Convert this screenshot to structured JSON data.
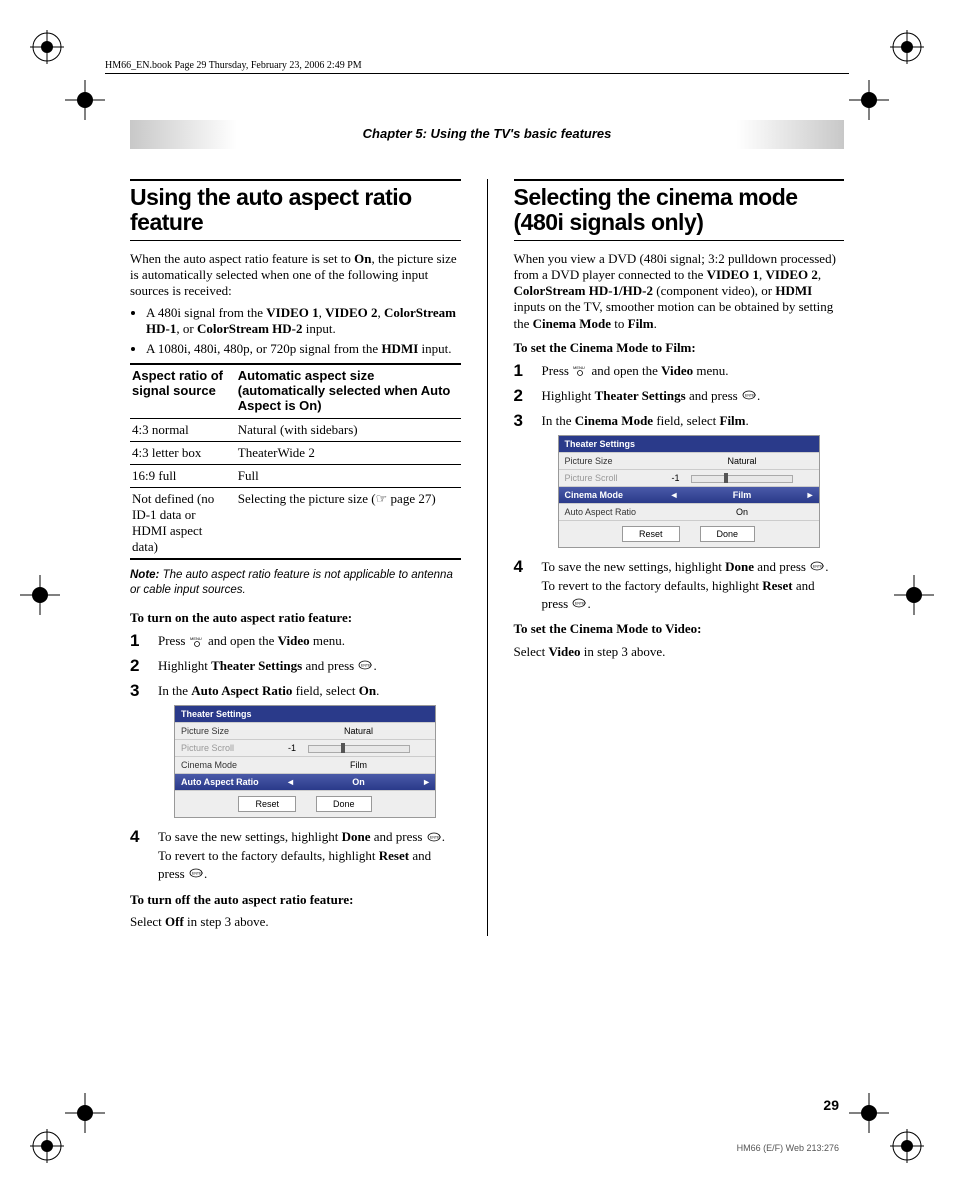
{
  "header": "HM66_EN.book  Page 29  Thursday, February 23, 2006  2:49 PM",
  "chapter": "Chapter 5: Using the TV's basic features",
  "page_number": "29",
  "footer_code": "HM66 (E/F) Web 213:276",
  "left": {
    "title": "Using the auto aspect ratio feature",
    "intro_a": "When the auto aspect ratio feature is set to ",
    "intro_on": "On",
    "intro_b": ", the picture size is automatically selected when one of the following input sources is received:",
    "bullet1_a": "A 480i signal from the ",
    "bullet1_v1": "VIDEO 1",
    "bullet1_sep1": ", ",
    "bullet1_v2": "VIDEO 2",
    "bullet1_sep2": ", ",
    "bullet1_cs1": "ColorStream HD-1",
    "bullet1_sep3": ", or ",
    "bullet1_cs2": "ColorStream HD-2",
    "bullet1_end": " input.",
    "bullet2_a": "A 1080i, 480i, 480p, or 720p signal from the ",
    "bullet2_hdmi": "HDMI",
    "bullet2_end": " input.",
    "table": {
      "h1": "Aspect ratio of signal source",
      "h2": "Automatic aspect size (automatically selected when Auto Aspect is On)",
      "rows": [
        {
          "a": "4:3 normal",
          "b": "Natural (with sidebars)"
        },
        {
          "a": "4:3 letter box",
          "b": "TheaterWide 2"
        },
        {
          "a": "16:9 full",
          "b": "Full"
        },
        {
          "a": "Not defined (no ID-1 data or HDMI aspect data)",
          "b": "Selecting the picture size (☞ page 27)"
        }
      ]
    },
    "note_label": "Note:",
    "note_text": " The auto aspect ratio feature is not applicable to antenna or cable input sources.",
    "proc_on_h": "To turn on the auto aspect ratio feature:",
    "steps_on": {
      "s1_a": "Press ",
      "s1_b": " and open the ",
      "s1_video": "Video",
      "s1_c": " menu.",
      "s2_a": "Highlight ",
      "s2_ts": "Theater Settings",
      "s2_b": " and press ",
      "s2_c": ".",
      "s3_a": "In the ",
      "s3_aar": "Auto Aspect Ratio",
      "s3_b": " field, select ",
      "s3_on": "On",
      "s3_c": ".",
      "s4_a": "To save the new settings, highlight ",
      "s4_done": "Done",
      "s4_b": " and press ",
      "s4_c": ". To revert to the factory defaults, highlight ",
      "s4_reset": "Reset",
      "s4_d": " and press ",
      "s4_e": "."
    },
    "osd": {
      "title": "Theater Settings",
      "r1_label": "Picture Size",
      "r1_val": "Natural",
      "r2_label": "Picture Scroll",
      "r2_val": "-1",
      "r3_label": "Cinema Mode",
      "r3_val": "Film",
      "r4_label": "Auto Aspect Ratio",
      "r4_val": "On",
      "btn_reset": "Reset",
      "btn_done": "Done"
    },
    "proc_off_h": "To turn off the auto aspect ratio feature:",
    "proc_off_a": "Select ",
    "proc_off_off": "Off",
    "proc_off_b": " in step 3 above."
  },
  "right": {
    "title": "Selecting the cinema mode (480i signals only)",
    "intro_a": "When you view a DVD (480i signal; 3:2 pulldown processed) from a DVD player connected to the ",
    "v1": "VIDEO 1",
    "sep1": ", ",
    "v2": "VIDEO 2",
    "sep2": ", ",
    "cs": "ColorStream HD-1/HD-2",
    "sep3": " (component video), or ",
    "hdmi": "HDMI",
    "intro_b": " inputs on the TV, smoother motion can be obtained by setting the ",
    "cm": "Cinema Mode",
    "intro_c": " to ",
    "film": "Film",
    "intro_d": ".",
    "proc_film_h": "To set the Cinema Mode to Film:",
    "steps": {
      "s1_a": "Press ",
      "s1_b": " and open the ",
      "s1_video": "Video",
      "s1_c": " menu.",
      "s2_a": "Highlight ",
      "s2_ts": "Theater Settings",
      "s2_b": " and press ",
      "s2_c": ".",
      "s3_a": "In the ",
      "s3_cm": "Cinema Mode",
      "s3_b": " field, select ",
      "s3_film": "Film",
      "s3_c": ".",
      "s4_a": "To save the new settings, highlight ",
      "s4_done": "Done",
      "s4_b": " and press ",
      "s4_c": ". To revert to the factory defaults, highlight ",
      "s4_reset": "Reset",
      "s4_d": " and press ",
      "s4_e": "."
    },
    "osd": {
      "title": "Theater Settings",
      "r1_label": "Picture Size",
      "r1_val": "Natural",
      "r2_label": "Picture Scroll",
      "r2_val": "-1",
      "r3_label": "Cinema Mode",
      "r3_val": "Film",
      "r4_label": "Auto Aspect Ratio",
      "r4_val": "On",
      "btn_reset": "Reset",
      "btn_done": "Done"
    },
    "proc_video_h": "To set the Cinema Mode to Video:",
    "proc_video_a": "Select ",
    "proc_video_video": "Video",
    "proc_video_b": " in step 3 above."
  }
}
